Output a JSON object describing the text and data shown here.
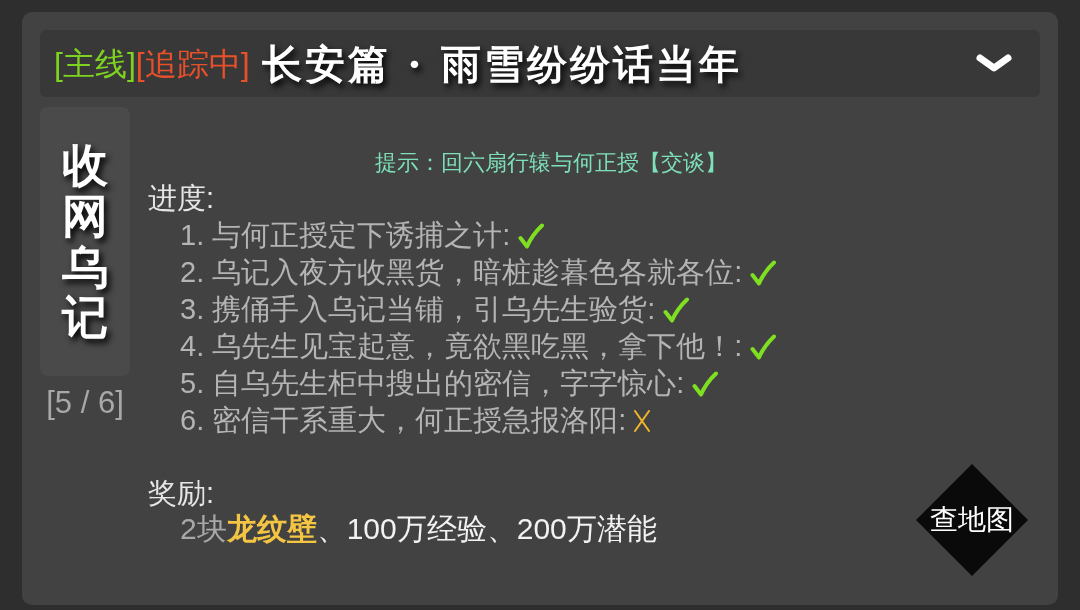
{
  "header": {
    "tags": [
      {
        "text": "[主线]",
        "color": "#7ed321"
      },
      {
        "text": "[追踪中]",
        "color": "#e8502a"
      }
    ],
    "title": "长安篇 · 雨雪纷纷话当年"
  },
  "quest": {
    "name": "收网乌记",
    "progress": "[5 / 6]"
  },
  "hint": "提示：回六扇行辕与何正授【交谈】",
  "progress_label": "进度:",
  "steps": [
    {
      "text": "1. 与何正授定下诱捕之计:",
      "done": true
    },
    {
      "text": "2. 乌记入夜方收黑货，暗桩趁暮色各就各位:",
      "done": true
    },
    {
      "text": "3. 携俑手入乌记当铺，引乌先生验货:",
      "done": true
    },
    {
      "text": "4. 乌先生见宝起意，竟欲黑吃黑，拿下他！:",
      "done": true
    },
    {
      "text": "5. 自乌先生柜中搜出的密信，字字惊心:",
      "done": true
    },
    {
      "text": "6. 密信干系重大，何正授急报洛阳:",
      "done": false
    }
  ],
  "rewards": {
    "label": "奖励:",
    "parts": [
      {
        "kind": "quantity",
        "text": "2块"
      },
      {
        "kind": "item",
        "text": "龙纹壁"
      },
      {
        "kind": "plain",
        "text": "、100万经验、200万潜能"
      }
    ]
  },
  "map_button": {
    "label": "查地图"
  }
}
